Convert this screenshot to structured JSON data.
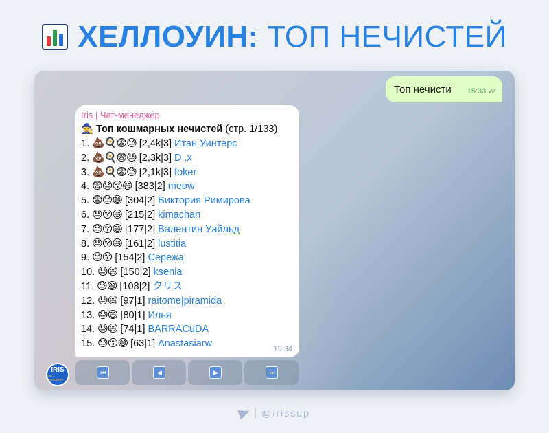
{
  "header": {
    "title_bold": "ХЕЛЛОУИН:",
    "title_rest": "ТОП НЕЧИСТЕЙ",
    "icon": "bar-chart-icon"
  },
  "chat": {
    "outgoing": {
      "text": "Топ нечисти",
      "time": "15:33",
      "status": "read"
    },
    "incoming": {
      "sender": "Iris | Чат-менеджер",
      "head_icon": "🧙",
      "heading_bold": "Топ кошмарных нечистей",
      "heading_rest": "(стр. 1/133)",
      "time": "15:34",
      "rows": [
        {
          "num": "1.",
          "emoji": "💩🍳😨😓",
          "stats": "[2,4k|3]",
          "user": "Итан Уинтерс"
        },
        {
          "num": "2.",
          "emoji": "💩🍳😨😓",
          "stats": "[2,3k|3]",
          "user": "D .x"
        },
        {
          "num": "3.",
          "emoji": "💩🍳😨😓",
          "stats": "[2,1k|3]",
          "user": "foker"
        },
        {
          "num": "4.",
          "emoji": "😨😓😚😄",
          "stats": "[383|2]",
          "user": "meow"
        },
        {
          "num": "5.",
          "emoji": "😨😓😄",
          "stats": "[304|2]",
          "user": "Виктория Римирова"
        },
        {
          "num": "6.",
          "emoji": "😓😚😄",
          "stats": "[215|2]",
          "user": "kimachan"
        },
        {
          "num": "7.",
          "emoji": "😓😚😄",
          "stats": "[177|2]",
          "user": "Валентин Уайльд"
        },
        {
          "num": "8.",
          "emoji": "😓😚😄",
          "stats": "[161|2]",
          "user": "lustitia"
        },
        {
          "num": "9.",
          "emoji": "😓😚",
          "stats": "[154|2]",
          "user": "Сережа"
        },
        {
          "num": "10.",
          "emoji": "😓😄",
          "stats": "[150|2]",
          "user": "ksenia"
        },
        {
          "num": "11.",
          "emoji": "😓😄",
          "stats": "[108|2]",
          "user": "クリス"
        },
        {
          "num": "12.",
          "emoji": "😓😄",
          "stats": "[97|1]",
          "user": "raitome|piramida"
        },
        {
          "num": "13.",
          "emoji": "😓😄",
          "stats": "[80|1]",
          "user": "Илья"
        },
        {
          "num": "14.",
          "emoji": "😓😄",
          "stats": "[74|1]",
          "user": "BARRACuDA"
        },
        {
          "num": "15.",
          "emoji": "😓😚😄",
          "stats": "[63|1]",
          "user": "Anastasiarw"
        }
      ]
    }
  },
  "avatar": {
    "line1": "IRIS",
    "line2": "ЧАТ-МЕНЕДЖЕР"
  },
  "keyboard": [
    {
      "name": "first-page-button",
      "icon": "⏮"
    },
    {
      "name": "prev-page-button",
      "icon": "◀"
    },
    {
      "name": "next-page-button",
      "icon": "▶"
    },
    {
      "name": "last-page-button",
      "icon": "⏭"
    }
  ],
  "footer": {
    "handle": "@irissup"
  },
  "colors": {
    "accent": "#2a82e0",
    "sender": "#e05e9c",
    "outgoing_bubble": "#e1fec6"
  }
}
